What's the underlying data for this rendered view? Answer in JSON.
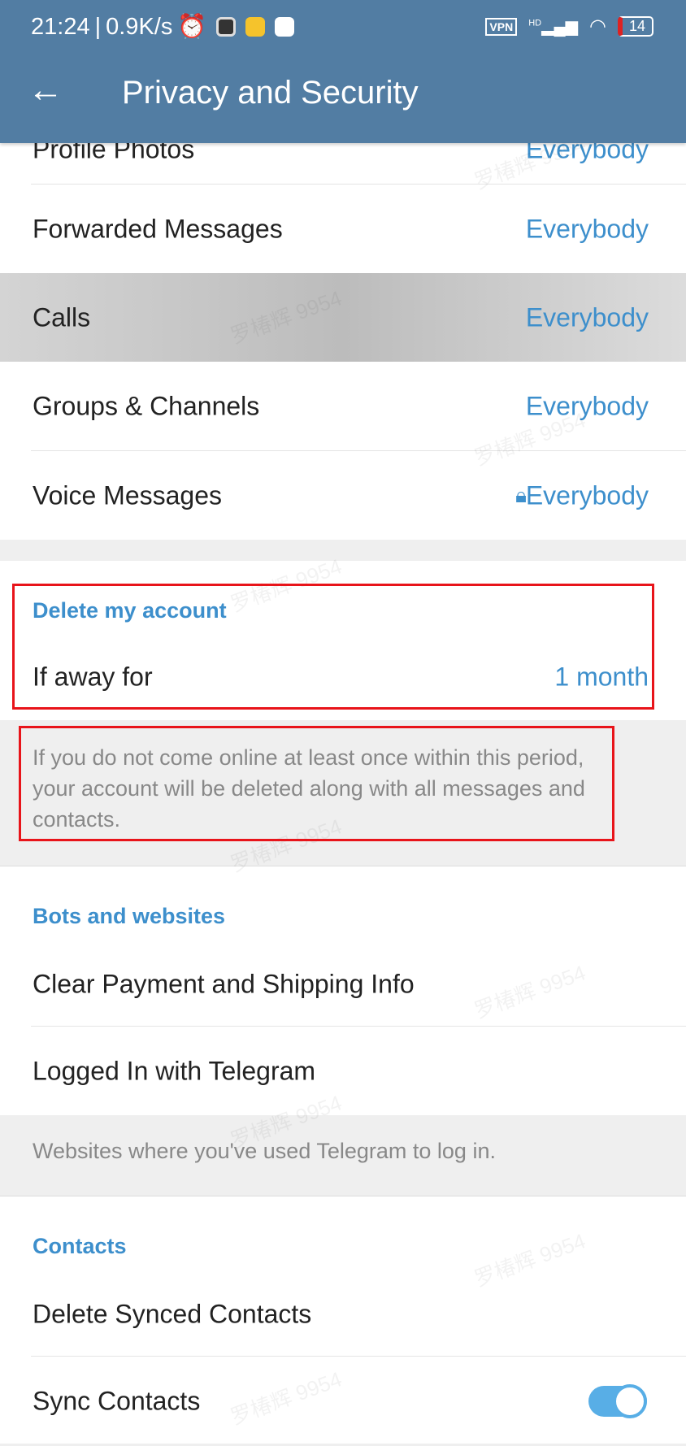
{
  "status_bar": {
    "time": "21:24",
    "speed": "0.9K/s",
    "vpn": "VPN",
    "network": "HD",
    "battery": "14"
  },
  "header": {
    "title": "Privacy and Security",
    "back_icon": "arrow-left-icon"
  },
  "privacy_rows": [
    {
      "label": "Profile Photos",
      "value": "Everybody"
    },
    {
      "label": "Forwarded Messages",
      "value": "Everybody"
    },
    {
      "label": "Calls",
      "value": "Everybody"
    },
    {
      "label": "Groups & Channels",
      "value": "Everybody"
    },
    {
      "label": "Voice Messages",
      "value": "Everybody",
      "icon": "lock-icon"
    }
  ],
  "delete_account": {
    "header": "Delete my account",
    "label": "If away for",
    "value": "1 month",
    "footer": "If you do not come online at least once within this period, your account will be deleted along with all messages and contacts."
  },
  "bots": {
    "header": "Bots and websites",
    "items": [
      "Clear Payment and Shipping Info",
      "Logged In with Telegram"
    ],
    "footer": "Websites where you've used Telegram to log in."
  },
  "contacts": {
    "header": "Contacts",
    "items": [
      "Delete Synced Contacts",
      "Sync Contacts"
    ],
    "sync_enabled": true
  },
  "watermark": "罗椿辉 9954",
  "colors": {
    "header": "#527da3",
    "accent": "#3d8fcc",
    "highlight": "#e8141a"
  }
}
